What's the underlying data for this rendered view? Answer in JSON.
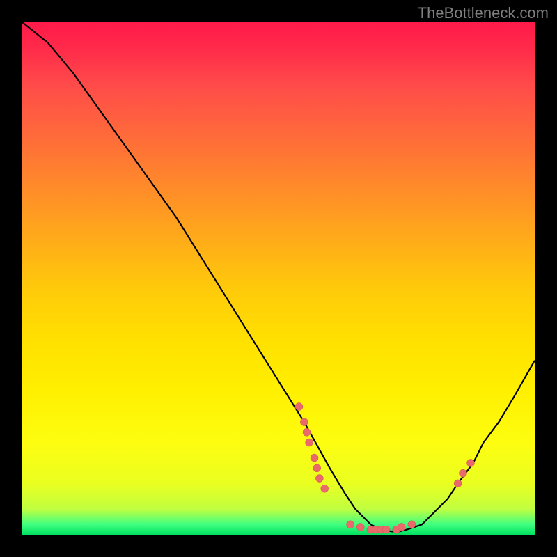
{
  "watermark": "TheBottleneck.com",
  "chart_data": {
    "type": "line",
    "title": "",
    "xlabel": "",
    "ylabel": "",
    "xlim": [
      0,
      100
    ],
    "ylim": [
      0,
      100
    ],
    "curve": {
      "name": "bottleneck-curve",
      "x": [
        0,
        5,
        10,
        15,
        20,
        25,
        30,
        35,
        40,
        45,
        50,
        55,
        60,
        63,
        65,
        68,
        70,
        73,
        75,
        78,
        80,
        83,
        85,
        88,
        90,
        93,
        96,
        100
      ],
      "y": [
        100,
        96,
        90,
        83,
        76,
        69,
        62,
        54,
        46,
        38,
        30,
        22,
        13,
        8,
        5,
        2,
        1,
        0.5,
        1,
        2,
        4,
        7,
        10,
        14,
        18,
        22,
        27,
        34
      ]
    },
    "scatter_points": [
      {
        "x": 54,
        "y": 25
      },
      {
        "x": 55,
        "y": 22
      },
      {
        "x": 55.5,
        "y": 20
      },
      {
        "x": 56,
        "y": 18
      },
      {
        "x": 57,
        "y": 15
      },
      {
        "x": 57.5,
        "y": 13
      },
      {
        "x": 58,
        "y": 11
      },
      {
        "x": 59,
        "y": 9
      },
      {
        "x": 64,
        "y": 2
      },
      {
        "x": 66,
        "y": 1.5
      },
      {
        "x": 68,
        "y": 1
      },
      {
        "x": 69,
        "y": 1
      },
      {
        "x": 70,
        "y": 1
      },
      {
        "x": 71,
        "y": 1
      },
      {
        "x": 73,
        "y": 1
      },
      {
        "x": 74,
        "y": 1.5
      },
      {
        "x": 76,
        "y": 2
      },
      {
        "x": 85,
        "y": 10
      },
      {
        "x": 86,
        "y": 12
      },
      {
        "x": 87.5,
        "y": 14
      }
    ]
  }
}
